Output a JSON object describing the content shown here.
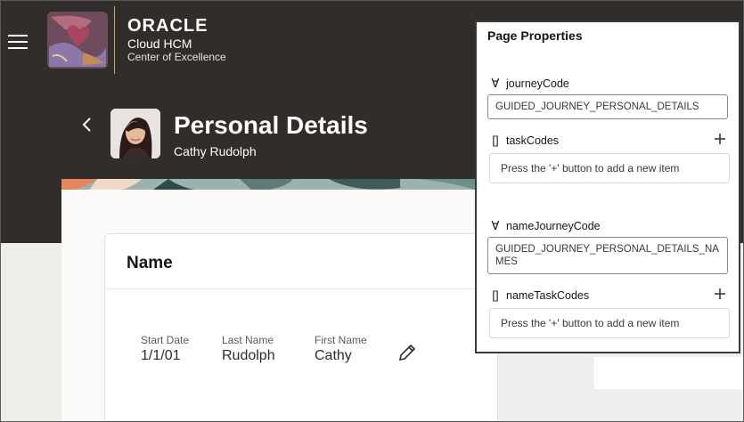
{
  "brand": {
    "name": "ORACLE",
    "product": "Cloud HCM",
    "tagline": "Center of Excellence"
  },
  "header": {
    "title": "Personal Details",
    "subtitle": "Cathy Rudolph"
  },
  "name_section": {
    "title": "Name",
    "fields": [
      {
        "label": "Start Date",
        "value": "1/1/01"
      },
      {
        "label": "Last Name",
        "value": "Rudolph"
      },
      {
        "label": "First Name",
        "value": "Cathy"
      }
    ]
  },
  "properties_panel": {
    "title": "Page Properties",
    "journeyCode": {
      "label": "journeyCode",
      "value": "GUIDED_JOURNEY_PERSONAL_DETAILS"
    },
    "taskCodes": {
      "label": "taskCodes",
      "placeholder": "Press the '+' button to add a new item"
    },
    "nameJourneyCode": {
      "label": "nameJourneyCode",
      "value": "GUIDED_JOURNEY_PERSONAL_DETAILS_NAMES"
    },
    "nameTaskCodes": {
      "label": "nameTaskCodes",
      "placeholder": "Press the '+' button to add a new item"
    }
  },
  "icons": {
    "menu": "hamburger-icon",
    "back": "chevron-left-icon",
    "edit": "pencil-icon",
    "string_type": "letter-a-icon",
    "array_type": "brackets-icon",
    "add": "plus-icon"
  },
  "colors": {
    "header_bg": "#312d2a",
    "panel_border": "#3a3a3a",
    "text_dark": "#161513"
  }
}
